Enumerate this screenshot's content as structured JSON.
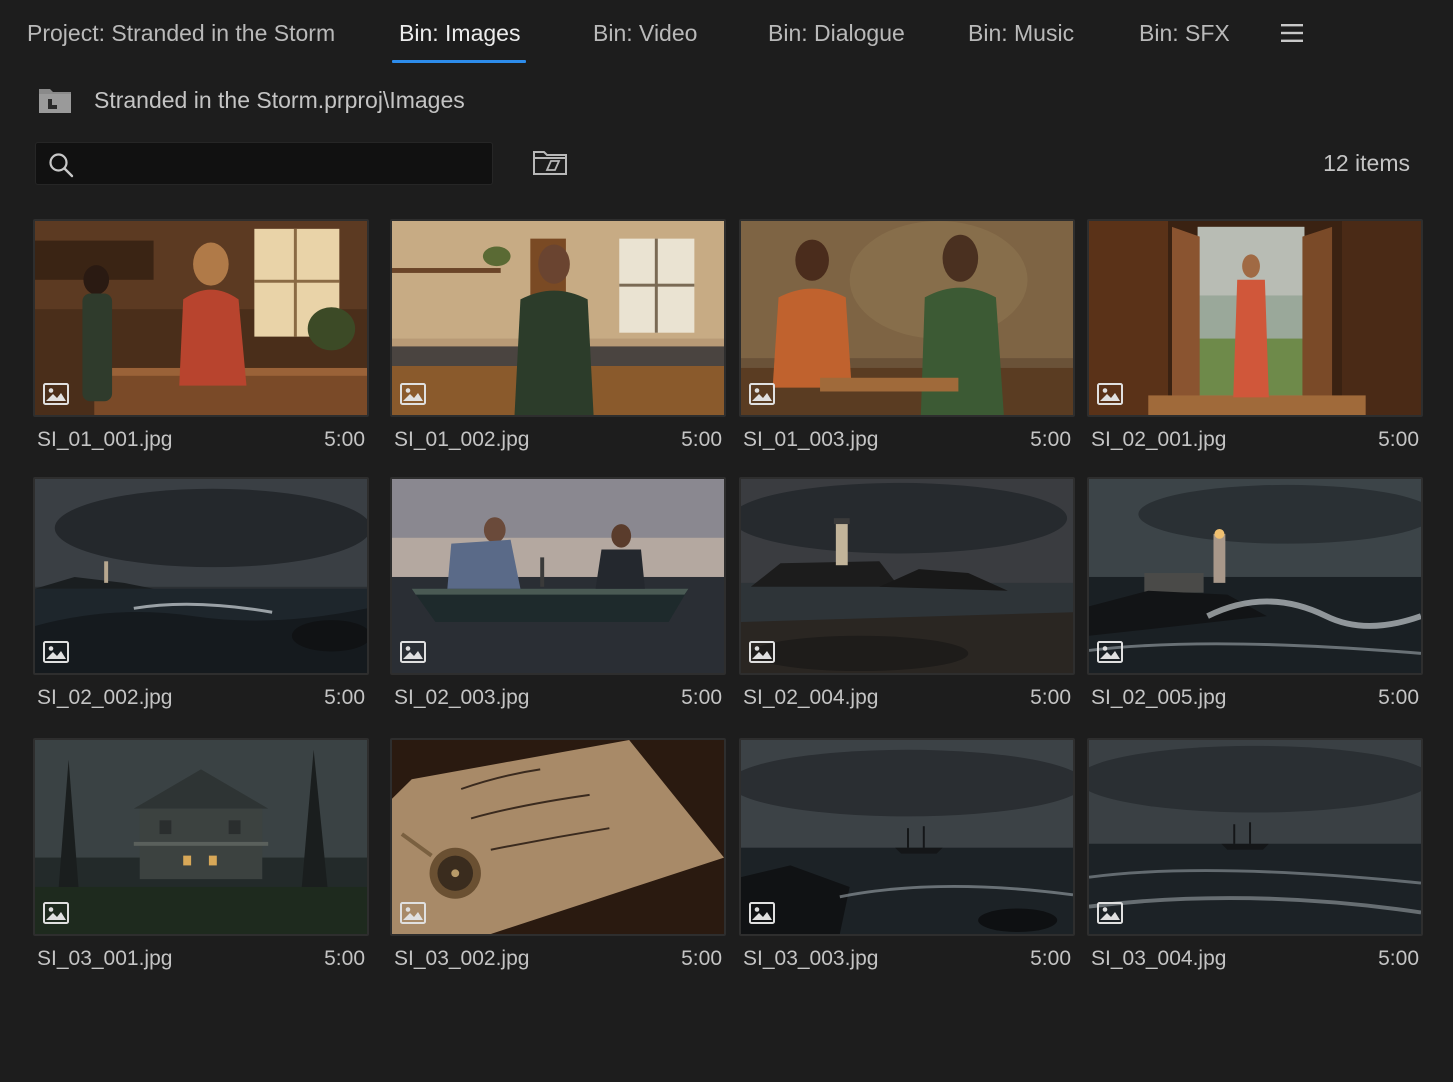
{
  "tabs": [
    {
      "label": "Project: Stranded in the Storm",
      "active": false
    },
    {
      "label": "Bin: Images",
      "active": true
    },
    {
      "label": "Bin: Video",
      "active": false
    },
    {
      "label": "Bin: Dialogue",
      "active": false
    },
    {
      "label": "Bin: Music",
      "active": false
    },
    {
      "label": "Bin: SFX",
      "active": false
    }
  ],
  "breadcrumb": {
    "path": "Stranded in the Storm.prproj\\Images"
  },
  "search": {
    "value": "",
    "placeholder": ""
  },
  "item_count": "12 items",
  "colors": {
    "accent": "#2d8ceb",
    "background": "#1d1d1d"
  },
  "items": [
    {
      "name": "SI_01_001.jpg",
      "duration": "5:00",
      "scene": "kitchen-warm"
    },
    {
      "name": "SI_01_002.jpg",
      "duration": "5:00",
      "scene": "kitchen-window"
    },
    {
      "name": "SI_01_003.jpg",
      "duration": "5:00",
      "scene": "kitchen-talk"
    },
    {
      "name": "SI_02_001.jpg",
      "duration": "5:00",
      "scene": "doorway"
    },
    {
      "name": "SI_02_002.jpg",
      "duration": "5:00",
      "scene": "storm-coast"
    },
    {
      "name": "SI_02_003.jpg",
      "duration": "5:00",
      "scene": "rowboat"
    },
    {
      "name": "SI_02_004.jpg",
      "duration": "5:00",
      "scene": "lighthouse-rocks"
    },
    {
      "name": "SI_02_005.jpg",
      "duration": "5:00",
      "scene": "lighthouse-waves"
    },
    {
      "name": "SI_03_001.jpg",
      "duration": "5:00",
      "scene": "old-house"
    },
    {
      "name": "SI_03_002.jpg",
      "duration": "5:00",
      "scene": "note-compass"
    },
    {
      "name": "SI_03_003.jpg",
      "duration": "5:00",
      "scene": "ship-rocks"
    },
    {
      "name": "SI_03_004.jpg",
      "duration": "5:00",
      "scene": "ship-sea"
    }
  ]
}
